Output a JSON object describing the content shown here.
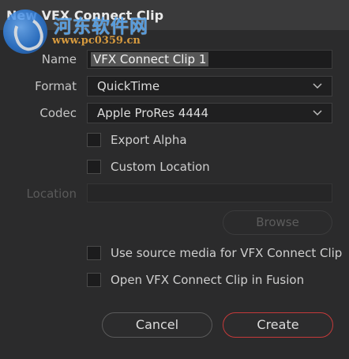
{
  "dialog": {
    "title": "New VFX Connect Clip",
    "watermark": {
      "title": "河东软件网",
      "url": "www.pc0359.cn"
    }
  },
  "fields": {
    "name_label": "Name",
    "name_value": "VFX Connect Clip 1",
    "format_label": "Format",
    "format_value": "QuickTime",
    "codec_label": "Codec",
    "codec_value": "Apple ProRes 4444",
    "location_label": "Location",
    "location_value": ""
  },
  "checkboxes": {
    "export_alpha": {
      "label": "Export Alpha",
      "checked": false
    },
    "custom_location": {
      "label": "Custom Location",
      "checked": false
    },
    "use_source_media": {
      "label": "Use source media for VFX Connect Clip",
      "checked": false
    },
    "open_in_fusion": {
      "label": "Open VFX Connect Clip in Fusion",
      "checked": false
    }
  },
  "buttons": {
    "browse": "Browse",
    "cancel": "Cancel",
    "create": "Create"
  },
  "colors": {
    "accent_create_border": "#c53a3a",
    "dialog_bg": "#2b2b2c"
  }
}
